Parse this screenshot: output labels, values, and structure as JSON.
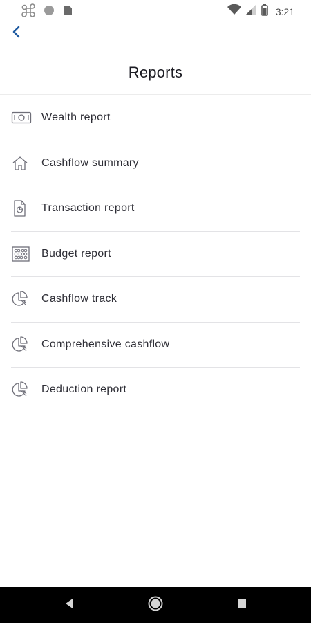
{
  "status_bar": {
    "time": "3:21",
    "left_icons": [
      "command-icon",
      "circle-icon",
      "sim-card-icon"
    ],
    "right_icons": [
      "wifi-icon",
      "signal-icon",
      "battery-icon"
    ]
  },
  "header": {
    "title": "Reports",
    "back_icon": "chevron-left-icon",
    "accent_color": "#1e5aa0"
  },
  "reports": [
    {
      "label": "Wealth report",
      "icon": "money-icon"
    },
    {
      "label": "Cashflow summary",
      "icon": "home-icon"
    },
    {
      "label": "Transaction report",
      "icon": "document-pie-icon"
    },
    {
      "label": "Budget report",
      "icon": "abacus-icon"
    },
    {
      "label": "Cashflow track",
      "icon": "pie-chart-icon"
    },
    {
      "label": "Comprehensive cashflow",
      "icon": "pie-chart-icon"
    },
    {
      "label": "Deduction report",
      "icon": "pie-chart-icon"
    }
  ],
  "nav_bar": {
    "back_icon": "triangle-back-icon",
    "home_icon": "circle-home-icon",
    "recents_icon": "square-recents-icon"
  }
}
